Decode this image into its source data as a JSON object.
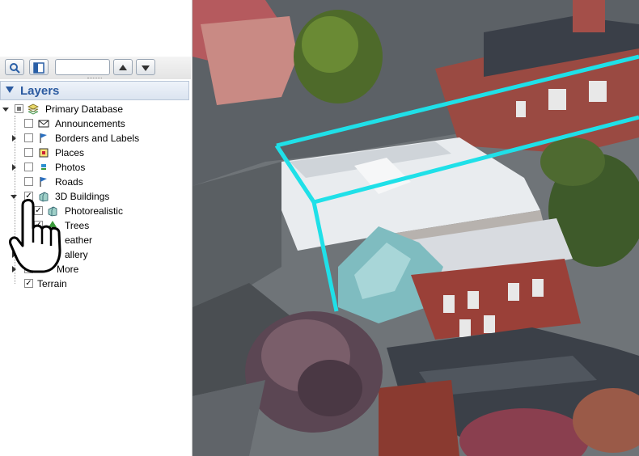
{
  "toolbar": {
    "search_value": "",
    "buttons": [
      {
        "icon": "magnifier-icon"
      },
      {
        "icon": "panel-toggle-icon"
      },
      {
        "icon": "arrow-up-icon"
      },
      {
        "icon": "arrow-down-icon"
      }
    ]
  },
  "layers": {
    "title": "Layers",
    "items": [
      {
        "label": "Primary Database",
        "checked": "partial",
        "icon": "database-icon"
      },
      {
        "label": "Announcements",
        "checked": false,
        "icon": "envelope-icon"
      },
      {
        "label": "Borders and Labels",
        "checked": false,
        "icon": "flag-icon"
      },
      {
        "label": "Places",
        "checked": false,
        "icon": "places-icon"
      },
      {
        "label": "Photos",
        "checked": false,
        "icon": "photo-icon"
      },
      {
        "label": "Roads",
        "checked": false,
        "icon": "flag-icon"
      },
      {
        "label": "3D Buildings",
        "checked": true,
        "icon": "building-icon"
      },
      {
        "label": "Photorealistic",
        "checked": true,
        "icon": "building-icon"
      },
      {
        "label": "Trees",
        "checked": true,
        "icon": "tree-icon"
      },
      {
        "label": "eather",
        "checked": false,
        "icon": "weather-icon"
      },
      {
        "label": "allery",
        "checked": false,
        "icon": "gallery-icon"
      },
      {
        "label": "More",
        "checked": false,
        "icon": "more-icon"
      },
      {
        "label": "Terrain",
        "checked": true,
        "icon": "terrain-icon"
      }
    ]
  },
  "map": {
    "highlight_color": "#1fe0e8",
    "cursor": "hand-pointer-icon"
  }
}
